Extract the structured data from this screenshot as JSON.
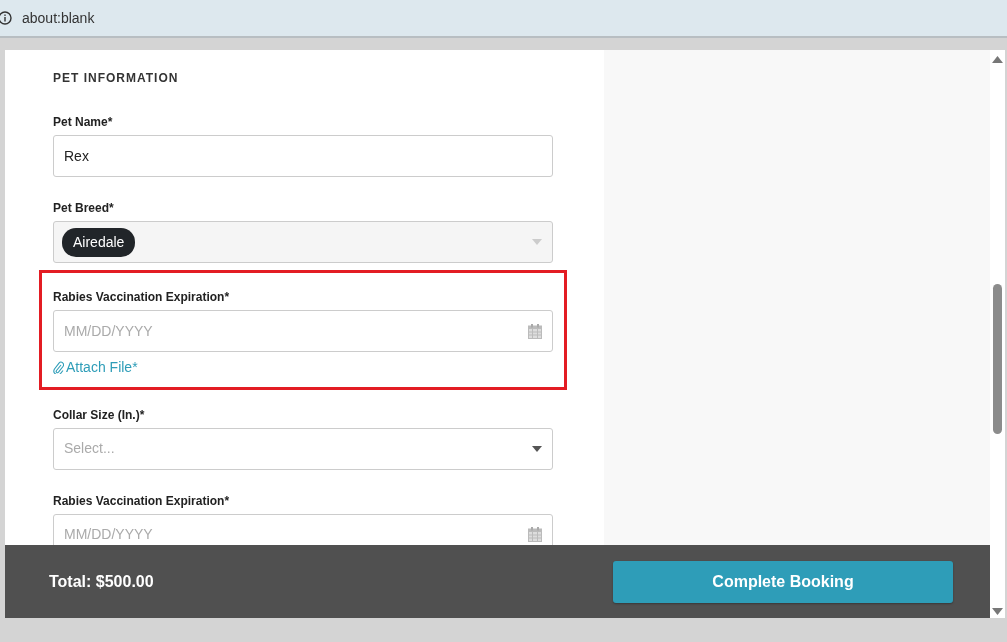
{
  "address_bar": {
    "url": "about:blank"
  },
  "section_title": "PET INFORMATION",
  "fields": [
    {
      "kind": "text",
      "label": "Pet Name*",
      "value": "Rex",
      "highlighted": false
    },
    {
      "kind": "tags",
      "label": "Pet Breed*",
      "tags": [
        "Airedale"
      ],
      "highlighted": false
    },
    {
      "kind": "date",
      "label": "Rabies Vaccination Expiration*",
      "placeholder": "MM/DD/YYYY",
      "attach": "Attach File*",
      "highlighted": true
    },
    {
      "kind": "select",
      "label": "Collar Size (In.)*",
      "placeholder": "Select...",
      "highlighted": false
    },
    {
      "kind": "date",
      "label": "Rabies Vaccination Expiration*",
      "placeholder": "MM/DD/YYYY",
      "highlighted": false
    }
  ],
  "footer": {
    "total": "Total: $500.00",
    "button": "Complete Booking"
  }
}
